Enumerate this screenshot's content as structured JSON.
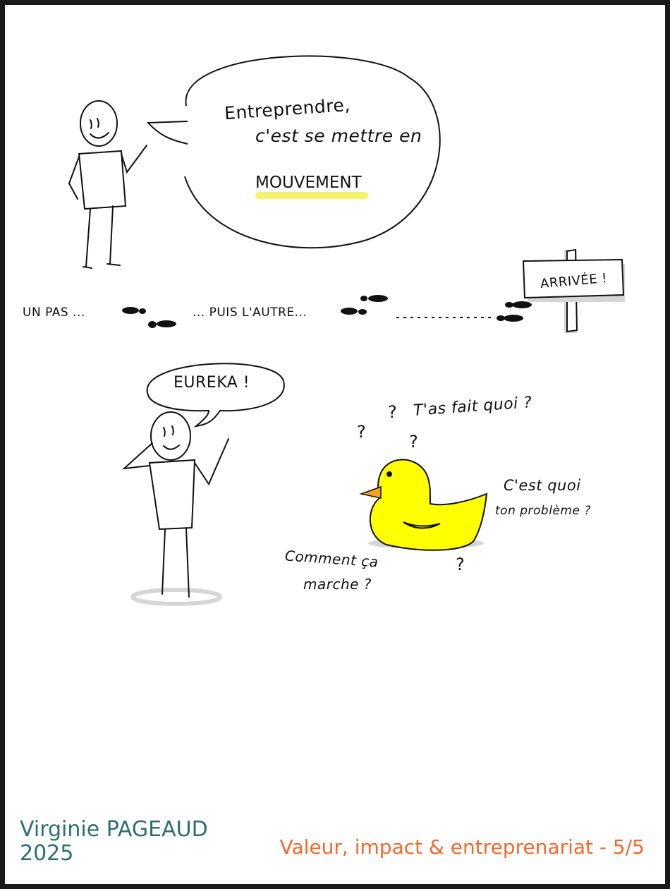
{
  "colors": {
    "frame": "#1a1a1a",
    "author": "#2e6f6c",
    "footer_title": "#f0692b",
    "highlight": "#f4f36b",
    "duck_body": "#ffff00",
    "duck_beak": "#f7a21b",
    "shadow": "#d6d6d6"
  },
  "speech1": {
    "line1": "Entreprendre,",
    "line2": "c'est se mettre en",
    "line3": "MOUVEMENT"
  },
  "steps": {
    "text1": "UN PAS ...",
    "text2": "... PUIS L'AUTRE...",
    "sign": "ARRIVÉE !"
  },
  "eureka": "EUREKA !",
  "duck": {
    "q1": "T'as fait quoi ?",
    "q2": "C'est quoi",
    "q3": "ton problème ?",
    "q4": "Comment ça",
    "q5": "marche ?",
    "question_mark": "?"
  },
  "footer": {
    "author": "Virginie PAGEAUD",
    "year": "2025",
    "title": "Valeur, impact & entreprenariat - 5/5"
  },
  "icons": [
    "stick-figure-icon",
    "speech-bubble-icon",
    "footprints-icon",
    "signpost-icon",
    "rubber-duck-icon"
  ]
}
